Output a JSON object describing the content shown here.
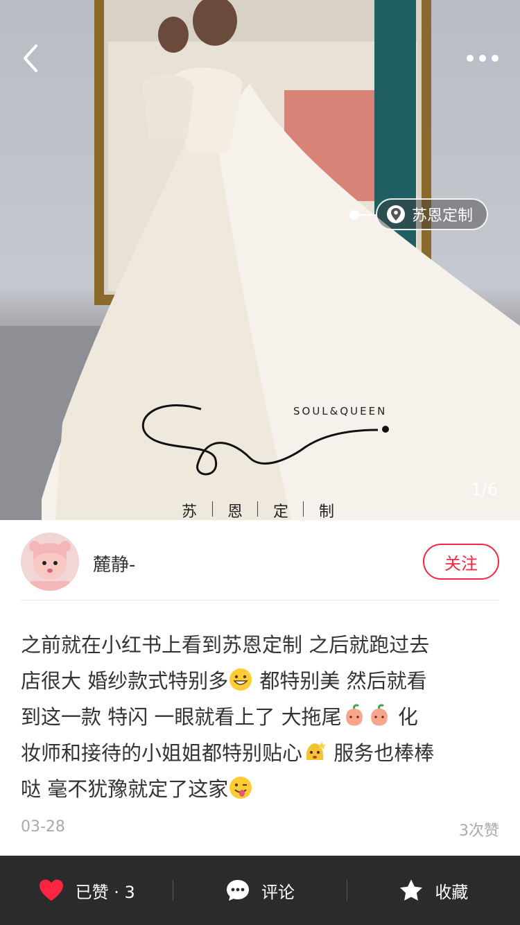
{
  "photo": {
    "location_tag": "苏恩定制",
    "brand_subtitle": "SOUL&QUEEN",
    "brand_chars": [
      "苏",
      "恩",
      "定",
      "制"
    ],
    "page_indicator": "1/6"
  },
  "author": {
    "name": "麓静-",
    "follow_label": "关注"
  },
  "content": {
    "lines": [
      "之前就在小红书上看到苏恩定制  之后就跑过去",
      "店很大  婚纱款式特别多",
      "  都特别美  然后就看",
      "到这一款  特闪  一眼就看上了  大拖尾",
      "  化",
      "妆师和接待的小姐姐都特别贴心",
      "  服务也棒棒",
      "哒  毫不犹豫就定了这家"
    ]
  },
  "meta": {
    "date": "03-28",
    "likes": "3次赞"
  },
  "bottom_bar": {
    "like_label": "已赞 · 3",
    "comment_label": "评论",
    "collect_label": "收藏",
    "like_color": "#ff2442"
  },
  "icons": [
    "back-arrow-icon",
    "more-icon",
    "location-pin-icon",
    "heart-icon",
    "comment-icon",
    "star-icon"
  ]
}
